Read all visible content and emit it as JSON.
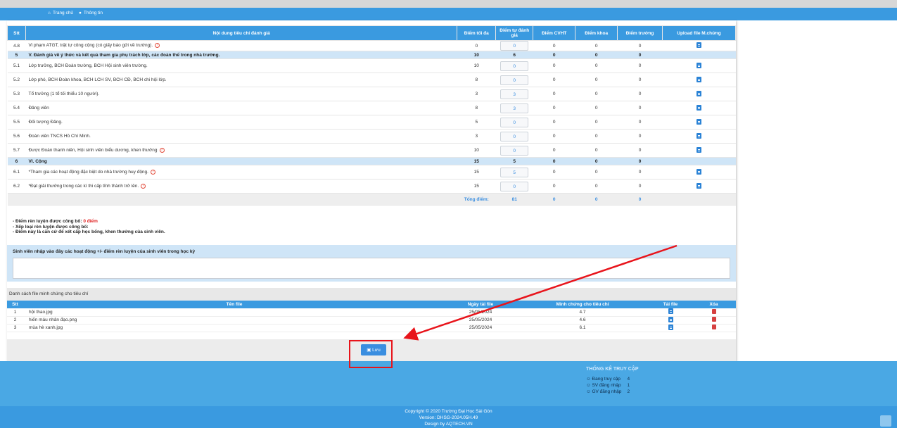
{
  "nav": {
    "home": "Trang chủ",
    "info": "Thông tin"
  },
  "criteria_table": {
    "headers": [
      "Stt",
      "Nội dung tiêu chí đánh giá",
      "Điểm tối đa",
      "Điểm tự đánh giá",
      "Điểm CVHT",
      "Điểm khoa",
      "Điểm trường",
      "Upload file M.chứng"
    ],
    "rows": [
      {
        "stt": "4.8",
        "content": "Vi phạm ATGT, trật tự công cộng (có giấy báo gửi về trường).",
        "max": "0",
        "self": "0",
        "cvht": "0",
        "khoa": "0",
        "truong": "0",
        "help": true,
        "upload": true,
        "section": false
      },
      {
        "stt": "5",
        "content": "V. Đánh giá về ý thức và kết quả tham gia phụ trách lớp, các đoàn thể trong nhà trường.",
        "max": "10",
        "self": "6",
        "cvht": "0",
        "khoa": "0",
        "truong": "0",
        "help": false,
        "upload": false,
        "section": true
      },
      {
        "stt": "5.1",
        "content": "Lớp trưởng, BCH Đoàn trường, BCH Hội sinh viên trường.",
        "max": "10",
        "self": "0",
        "cvht": "0",
        "khoa": "0",
        "truong": "0",
        "help": false,
        "upload": true,
        "section": false
      },
      {
        "stt": "5.2",
        "content": "Lớp phó, BCH Đoàn khoa, BCH LCH SV, BCH CĐ, BCH chi hội lớp.",
        "max": "8",
        "self": "0",
        "cvht": "0",
        "khoa": "0",
        "truong": "0",
        "help": false,
        "upload": true,
        "section": false
      },
      {
        "stt": "5.3",
        "content": "Tổ trưởng (1 tổ tối thiểu 10 người).",
        "max": "3",
        "self": "3",
        "cvht": "0",
        "khoa": "0",
        "truong": "0",
        "help": false,
        "upload": true,
        "section": false
      },
      {
        "stt": "5.4",
        "content": "Đảng viên",
        "max": "8",
        "self": "3",
        "cvht": "0",
        "khoa": "0",
        "truong": "0",
        "help": false,
        "upload": true,
        "section": false
      },
      {
        "stt": "5.5",
        "content": "Đối tượng Đảng.",
        "max": "5",
        "self": "0",
        "cvht": "0",
        "khoa": "0",
        "truong": "0",
        "help": false,
        "upload": true,
        "section": false
      },
      {
        "stt": "5.6",
        "content": "Đoàn viên TNCS Hồ Chí Minh.",
        "max": "3",
        "self": "0",
        "cvht": "0",
        "khoa": "0",
        "truong": "0",
        "help": false,
        "upload": true,
        "section": false
      },
      {
        "stt": "5.7",
        "content": "Được Đoàn thanh niên, Hội sinh viên biểu dương, khen thưởng",
        "max": "10",
        "self": "0",
        "cvht": "0",
        "khoa": "0",
        "truong": "0",
        "help": true,
        "upload": true,
        "section": false
      },
      {
        "stt": "6",
        "content": "VI. Cộng",
        "max": "15",
        "self": "5",
        "cvht": "0",
        "khoa": "0",
        "truong": "0",
        "help": false,
        "upload": false,
        "section": true
      },
      {
        "stt": "6.1",
        "content": "*Tham gia các hoạt động đặc biệt do nhà trường huy động.",
        "max": "15",
        "self": "5",
        "cvht": "0",
        "khoa": "0",
        "truong": "0",
        "help": true,
        "upload": true,
        "section": false
      },
      {
        "stt": "6.2",
        "content": "*Đạt giải thưởng trong các kì thi cấp tỉnh thành trở lên.",
        "max": "15",
        "self": "0",
        "cvht": "0",
        "khoa": "0",
        "truong": "0",
        "help": true,
        "upload": true,
        "section": false
      }
    ],
    "total": {
      "label": "Tổng điểm:",
      "self": "81",
      "cvht": "0",
      "khoa": "0",
      "truong": "0"
    }
  },
  "notes": {
    "line1_prefix": "- Điểm rèn luyện được công bố:",
    "line1_value": "0 điểm",
    "line2": "- Xếp loại rèn luyện được công bố:",
    "line3": "- Điểm này là căn cứ để xét cấp học bổng, khen thưởng của sinh viên."
  },
  "activity_note": {
    "label": "Sinh viên nhập vào đây các hoạt động +/- điểm rèn luyện của sinh viên trong học kỳ",
    "value": ""
  },
  "files": {
    "section_title": "Danh sách file minh chứng cho tiêu chí",
    "headers": [
      "Stt",
      "Tên file",
      "Ngày tải file",
      "Minh chứng cho tiêu chí",
      "Tải file",
      "Xóa"
    ],
    "rows": [
      {
        "stt": "1",
        "name": "hội thao.jpg",
        "date": "25/05/2024",
        "criterion": "4.7"
      },
      {
        "stt": "2",
        "name": "hiến máu nhân đạo.png",
        "date": "25/05/2024",
        "criterion": "4.6"
      },
      {
        "stt": "3",
        "name": "mùa hè xanh.jpg",
        "date": "25/05/2024",
        "criterion": "6.1"
      }
    ]
  },
  "save_button": "Lưu",
  "stats": {
    "title": "THỐNG KÊ TRUY CẬP",
    "items": [
      {
        "label": "Đang truy cập",
        "value": "4"
      },
      {
        "label": "SV đăng nhập",
        "value": "1"
      },
      {
        "label": "GV đăng nhập",
        "value": "2"
      }
    ]
  },
  "footer": {
    "copyright": "Copyright © 2020 Trường Đại Học Sài Gòn",
    "version": "Version: DHSG-2024.05H.49",
    "design": "Design by AQTECH.VN"
  },
  "colors": {
    "nav": "#3a9ae0",
    "section_row": "#cfe5f7",
    "annotation": "#e8141b"
  }
}
